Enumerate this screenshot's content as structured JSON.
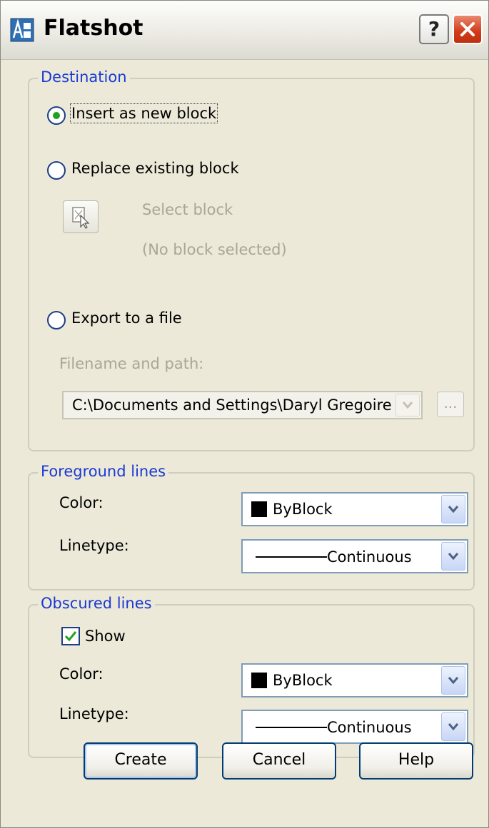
{
  "window": {
    "title": "Flatshot"
  },
  "destination": {
    "legend": "Destination",
    "insert_label": "Insert as new block",
    "replace_label": "Replace existing block",
    "select_block_label": "Select block",
    "no_block_label": "(No block selected)",
    "export_label": "Export to a file",
    "filename_label": "Filename and path:",
    "filename_value": "C:\\Documents and Settings\\Daryl Gregoire",
    "browse_label": "...",
    "selected": "insert"
  },
  "foreground": {
    "legend": "Foreground lines",
    "color_label": "Color:",
    "color_value": "ByBlock",
    "linetype_label": "Linetype:",
    "linetype_value": "Continuous"
  },
  "obscured": {
    "legend": "Obscured lines",
    "show_label": "Show",
    "show_checked": true,
    "color_label": "Color:",
    "color_value": "ByBlock",
    "linetype_label": "Linetype:",
    "linetype_value": "Continuous"
  },
  "buttons": {
    "create": "Create",
    "cancel": "Cancel",
    "help": "Help"
  },
  "colors": {
    "accent_text": "#1a3ad4",
    "dialog_bg": "#ece9d8",
    "radio_dot": "#21a121",
    "close_red": "#d23a18"
  }
}
